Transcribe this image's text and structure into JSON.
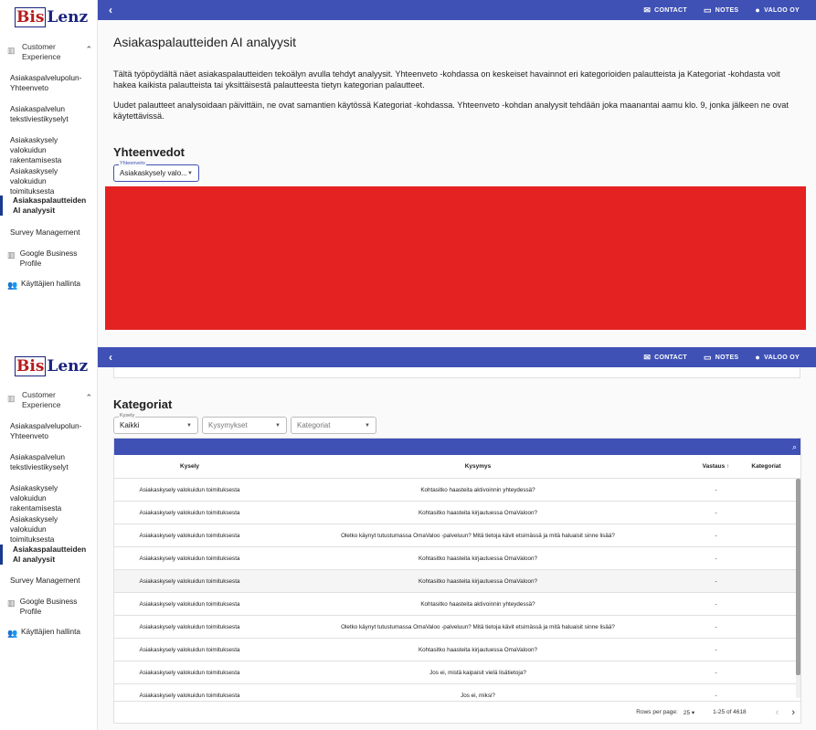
{
  "brand": {
    "part1": "Bis",
    "part2": "Lenz"
  },
  "sidebar": {
    "group_label": "Customer Experience",
    "items": [
      {
        "label": "Asiakaspalvelupolun- Yhteenveto"
      },
      {
        "label": "Asiakaspalvelun tekstiviestikyselyt"
      },
      {
        "label": "Asiakaskysely valokuidun rakentamisesta"
      },
      {
        "label": "Asiakaskysely valokuidun toimituksesta"
      },
      {
        "label": "Asiakaspalautteiden AI analyysit"
      },
      {
        "label": "Survey Management"
      },
      {
        "label": "Google Business Profile"
      },
      {
        "label": "Käyttäjien hallinta"
      }
    ]
  },
  "topbar": {
    "contact": "CONTACT",
    "notes": "NOTES",
    "account": "VALOO OY"
  },
  "page": {
    "title": "Asiakaspalautteiden AI analyysit",
    "intro1": "Tältä työpöydältä näet asiakaspalautteiden tekoälyn avulla tehdyt analyysit. Yhteenveto -kohdassa on keskeiset havainnot eri kategorioiden palautteista ja Kategoriat -kohdasta voit hakea kaikista palautteista tai yksittäisestä palautteesta tietyn kategorian palautteet.",
    "intro2": "Uudet palautteet analysoidaan päivittäin, ne ovat samantien käytössä Kategoriat -kohdassa. Yhteenveto -kohdan analyysit tehdään joka maanantai aamu klo. 9, jonka jälkeen ne ovat käytettävissä."
  },
  "summary": {
    "title": "Yhteenvedot",
    "select_label": "Yhteenveto",
    "select_value": "Asiakaskysely valo..."
  },
  "categories": {
    "title": "Kategoriat",
    "filter_survey_label": "Kysely",
    "filter_survey_value": "Kaikki",
    "filter_questions_placeholder": "Kysymykset",
    "filter_categories_placeholder": "Kategoriat",
    "columns": [
      "Kysely",
      "Kysymys",
      "Vastaus",
      "Kategoriat"
    ],
    "sort_arrow": "↑",
    "rows": [
      {
        "survey": "Asiakaskysely valokuidun toimituksesta",
        "question": "Kohtasitko haasteita aktivoinnin yhteydessä?",
        "answer": "-",
        "category": ""
      },
      {
        "survey": "Asiakaskysely valokuidun toimituksesta",
        "question": "Kohtasitko haasteita kirjautuessa OmaValoon?",
        "answer": "-",
        "category": ""
      },
      {
        "survey": "Asiakaskysely valokuidun toimituksesta",
        "question": "Oletko käynyt tutustumassa OmaValoo -palveluun? Mitä tietoja kävit etsimässä ja mitä haluaisit sinne lisää?",
        "answer": "-",
        "category": ""
      },
      {
        "survey": "Asiakaskysely valokuidun toimituksesta",
        "question": "Kohtasitko haasteita kirjautuessa OmaValoon?",
        "answer": "-",
        "category": ""
      },
      {
        "survey": "Asiakaskysely valokuidun toimituksesta",
        "question": "Kohtasitko haasteita kirjautuessa OmaValoon?",
        "answer": "-",
        "category": ""
      },
      {
        "survey": "Asiakaskysely valokuidun toimituksesta",
        "question": "Kohtasitko haasteita aktivoinnin yhteydessä?",
        "answer": "-",
        "category": ""
      },
      {
        "survey": "Asiakaskysely valokuidun toimituksesta",
        "question": "Oletko käynyt tutustumassa OmaValoo -palveluun? Mitä tietoja kävit etsimässä ja mitä haluaisit sinne lisää?",
        "answer": "-",
        "category": ""
      },
      {
        "survey": "Asiakaskysely valokuidun toimituksesta",
        "question": "Kohtasitko haasteita kirjautuessa OmaValoon?",
        "answer": "-",
        "category": ""
      },
      {
        "survey": "Asiakaskysely valokuidun toimituksesta",
        "question": "Jos ei, mistä kaipaisit vielä lisätietoja?",
        "answer": "-",
        "category": ""
      },
      {
        "survey": "Asiakaskysely valokuidun toimituksesta",
        "question": "Jos ei, miksi?",
        "answer": "-",
        "category": ""
      }
    ],
    "pager": {
      "rows_per_page_label": "Rows per page:",
      "rows_per_page": "25",
      "range": "1-25 of 4618"
    }
  },
  "colors": {
    "primary": "#3f51b5",
    "redaction": "#e42222",
    "brand_red": "#b71c1c",
    "brand_navy": "#1a237e"
  },
  "icons": [
    "chevron-left-icon",
    "mail-icon",
    "folder-icon",
    "account-circle-icon",
    "bar-chart-icon",
    "chevron-up-icon",
    "people-icon",
    "search-icon",
    "arrow-up-icon",
    "chevron-right-icon"
  ]
}
